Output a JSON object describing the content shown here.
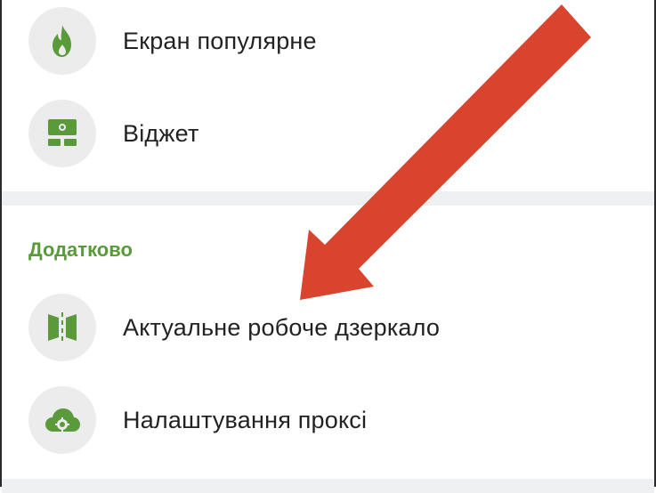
{
  "menu_top": {
    "items": [
      {
        "label": "Екран популярне",
        "icon": "flame-icon"
      },
      {
        "label": "Віджет",
        "icon": "widget-icon"
      }
    ]
  },
  "section_extra": {
    "title": "Додатково",
    "items": [
      {
        "label": "Актуальне робоче дзеркало",
        "icon": "mirror-icon"
      },
      {
        "label": "Налаштування проксі",
        "icon": "cloud-gear-icon"
      }
    ]
  },
  "colors": {
    "accent_green": "#5a9a3a",
    "icon_bg": "#ececec",
    "annotation_arrow": "#d9442e"
  }
}
